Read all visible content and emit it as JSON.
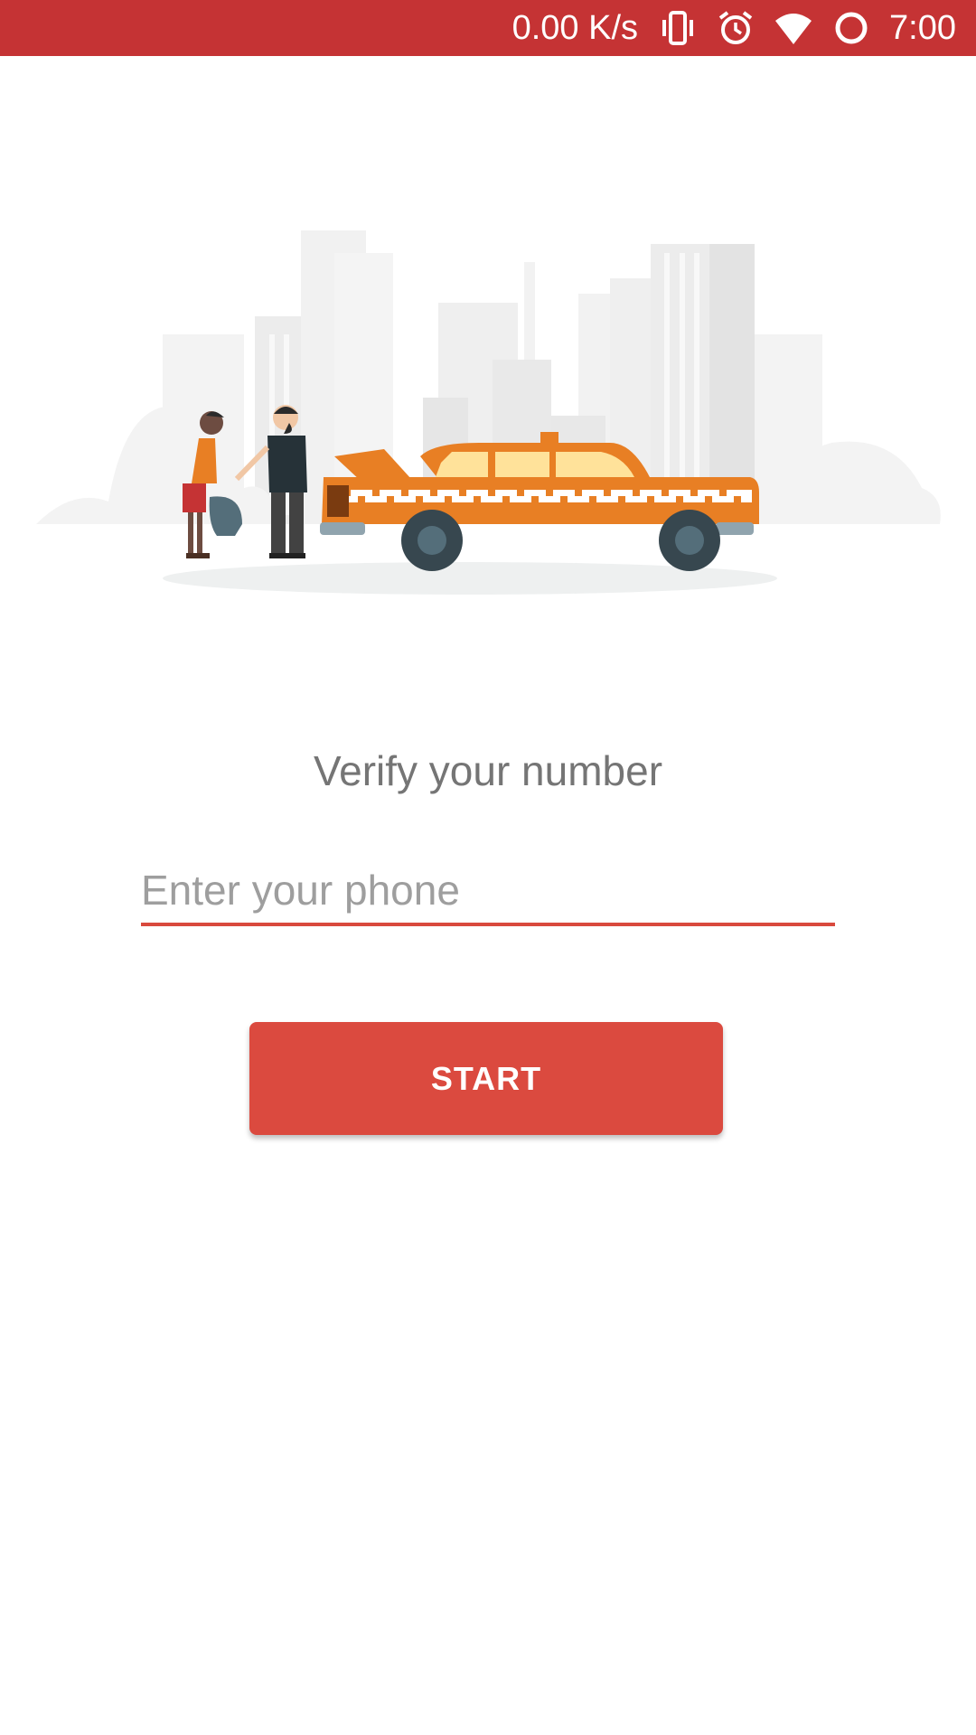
{
  "status_bar": {
    "network_speed": "0.00 K/s",
    "time": "7:00",
    "icons": [
      "vibrate-icon",
      "alarm-icon",
      "wifi-icon",
      "circle-icon"
    ],
    "background_color": "#c53334"
  },
  "hero": {
    "illustration": "taxi-illustration"
  },
  "main": {
    "title": "Verify your number",
    "phone_placeholder": "Enter your phone",
    "start_label": "START",
    "accent_color": "#db4a3f"
  }
}
